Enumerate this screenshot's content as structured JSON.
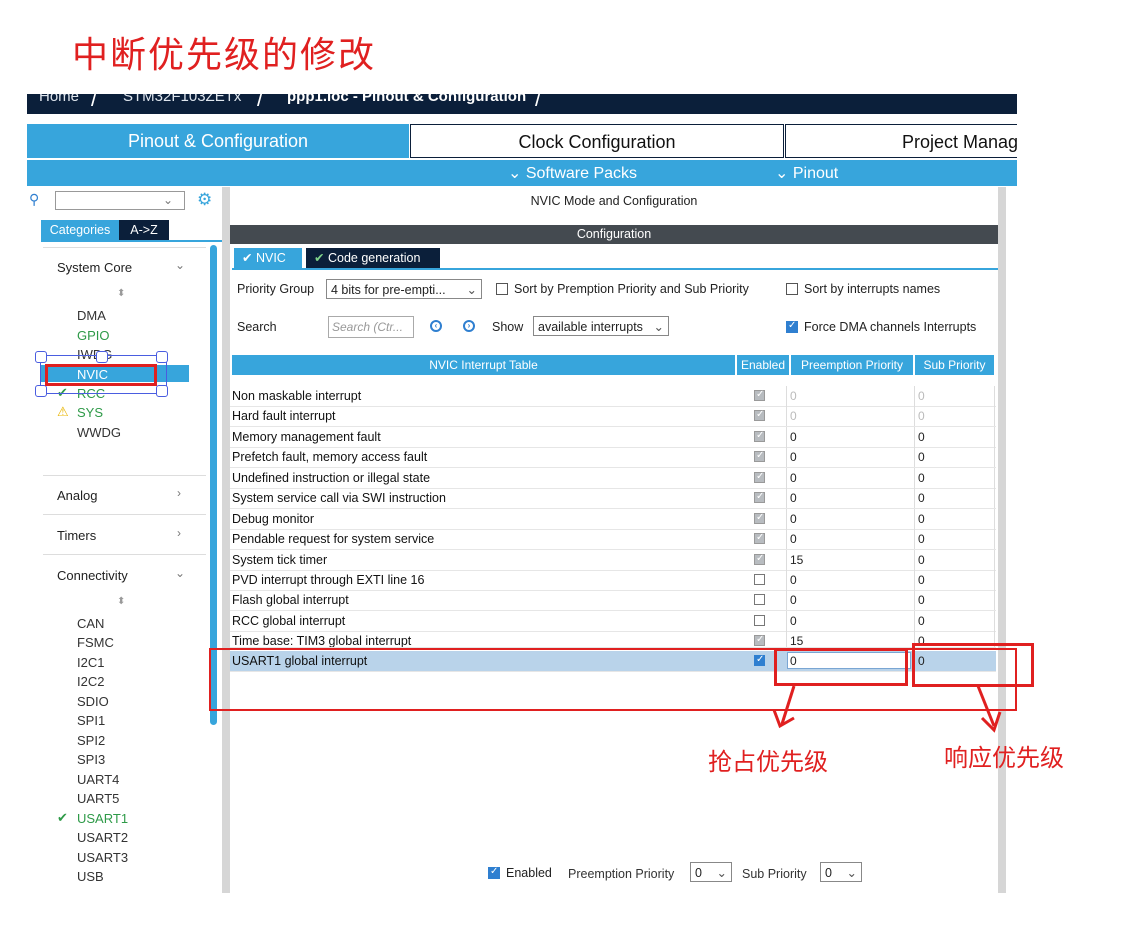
{
  "annotation": {
    "title": "中断优先级的修改",
    "preemption_label": "抢占优先级",
    "sub_label": "响应优先级",
    "color": "#e02020"
  },
  "breadcrumb": {
    "home": "Home",
    "chip": "STM32F103ZETx",
    "file": "ppp1.ioc - Pinout & Configuration"
  },
  "tabs": [
    {
      "label": "Pinout & Configuration",
      "active": true
    },
    {
      "label": "Clock Configuration",
      "active": false
    },
    {
      "label": "Project Manag",
      "active": false
    }
  ],
  "subbar": {
    "software_packs": "Software Packs",
    "pinout": "Pinout"
  },
  "sidebar": {
    "tab_categories": "Categories",
    "tab_az": "A->Z",
    "system_core": {
      "label": "System Core",
      "items": [
        "DMA",
        "GPIO",
        "IWDG",
        "NVIC",
        "RCC",
        "SYS",
        "WWDG"
      ]
    },
    "analog": "Analog",
    "timers": "Timers",
    "connectivity": {
      "label": "Connectivity",
      "items": [
        "CAN",
        "FSMC",
        "I2C1",
        "I2C2",
        "SDIO",
        "SPI1",
        "SPI2",
        "SPI3",
        "UART4",
        "UART5",
        "USART1",
        "USART2",
        "USART3",
        "USB"
      ]
    }
  },
  "panel": {
    "mode_title": "NVIC Mode and Configuration",
    "config_title": "Configuration",
    "tab_nvic": "NVIC",
    "tab_codegen": "Code generation",
    "priority_group_label": "Priority Group",
    "priority_group_value": "4 bits for pre-empti...",
    "sort_premption": "Sort by Premption Priority and Sub Priority",
    "sort_names": "Sort by interrupts names",
    "search_label": "Search",
    "search_placeholder": "Search (Ctr...",
    "show_label": "Show",
    "show_value": "available interrupts",
    "force_dma": "Force DMA channels Interrupts",
    "table_header": "NVIC Interrupt Table",
    "col_enabled": "Enabled",
    "col_preemption": "Preemption Priority",
    "col_sub": "Sub Priority"
  },
  "interrupts": [
    {
      "name": "Non maskable interrupt",
      "enabled": true,
      "locked": true,
      "preemption": "0",
      "sub": "0",
      "grey": true
    },
    {
      "name": "Hard fault interrupt",
      "enabled": true,
      "locked": true,
      "preemption": "0",
      "sub": "0",
      "grey": true
    },
    {
      "name": "Memory management fault",
      "enabled": true,
      "locked": true,
      "preemption": "0",
      "sub": "0"
    },
    {
      "name": "Prefetch fault, memory access fault",
      "enabled": true,
      "locked": true,
      "preemption": "0",
      "sub": "0"
    },
    {
      "name": "Undefined instruction or illegal state",
      "enabled": true,
      "locked": true,
      "preemption": "0",
      "sub": "0"
    },
    {
      "name": "System service call via SWI instruction",
      "enabled": true,
      "locked": true,
      "preemption": "0",
      "sub": "0"
    },
    {
      "name": "Debug monitor",
      "enabled": true,
      "locked": true,
      "preemption": "0",
      "sub": "0"
    },
    {
      "name": "Pendable request for system service",
      "enabled": true,
      "locked": true,
      "preemption": "0",
      "sub": "0"
    },
    {
      "name": "System tick timer",
      "enabled": true,
      "locked": true,
      "preemption": "15",
      "sub": "0"
    },
    {
      "name": "PVD interrupt through EXTI line 16",
      "enabled": false,
      "preemption": "0",
      "sub": "0"
    },
    {
      "name": "Flash global interrupt",
      "enabled": false,
      "preemption": "0",
      "sub": "0"
    },
    {
      "name": "RCC global interrupt",
      "enabled": false,
      "preemption": "0",
      "sub": "0"
    },
    {
      "name": "Time base: TIM3 global interrupt",
      "enabled": true,
      "locked": true,
      "preemption": "15",
      "sub": "0"
    },
    {
      "name": "USART1 global interrupt",
      "enabled": true,
      "selected": true,
      "preemption": "0",
      "sub": "0"
    }
  ],
  "bottom": {
    "enabled_label": "Enabled",
    "preemption_label": "Preemption Priority",
    "preemption_value": "0",
    "sub_label": "Sub Priority",
    "sub_value": "0"
  },
  "colors": {
    "accent": "#37a5dc",
    "dark_navy": "#0b1f3a",
    "check_green": "#2e9a48",
    "selected_row": "#b9d3ea"
  }
}
